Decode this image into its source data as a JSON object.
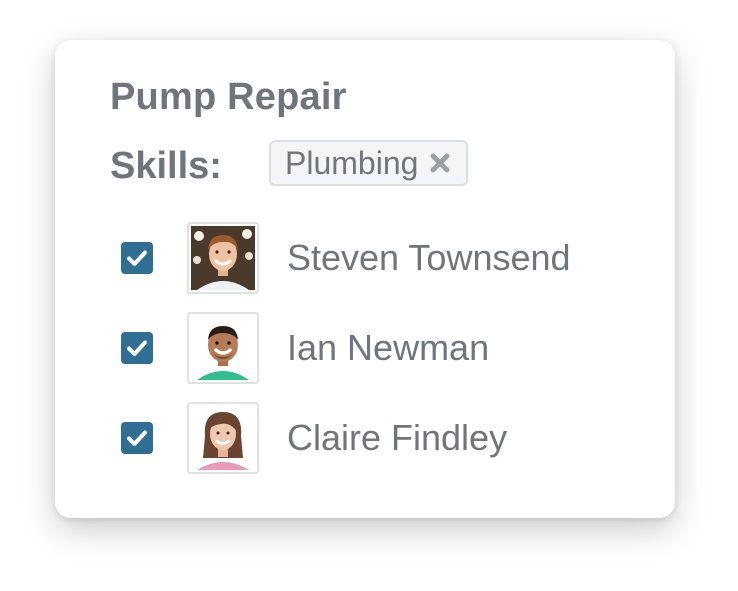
{
  "task": {
    "title": "Pump Repair"
  },
  "skills": {
    "label": "Skills:",
    "tags": [
      {
        "label": "Plumbing",
        "remove_icon": "x-icon"
      }
    ]
  },
  "assignees": [
    {
      "name": "Steven Townsend",
      "checked": true,
      "avatar": "avatar-steven"
    },
    {
      "name": "Ian Newman",
      "checked": true,
      "avatar": "avatar-ian"
    },
    {
      "name": "Claire Findley",
      "checked": true,
      "avatar": "avatar-claire"
    }
  ],
  "colors": {
    "text": "#70757c",
    "checkbox": "#2f6f94",
    "tag_bg": "#f4f5f6",
    "tag_border": "#dcdfe2"
  }
}
